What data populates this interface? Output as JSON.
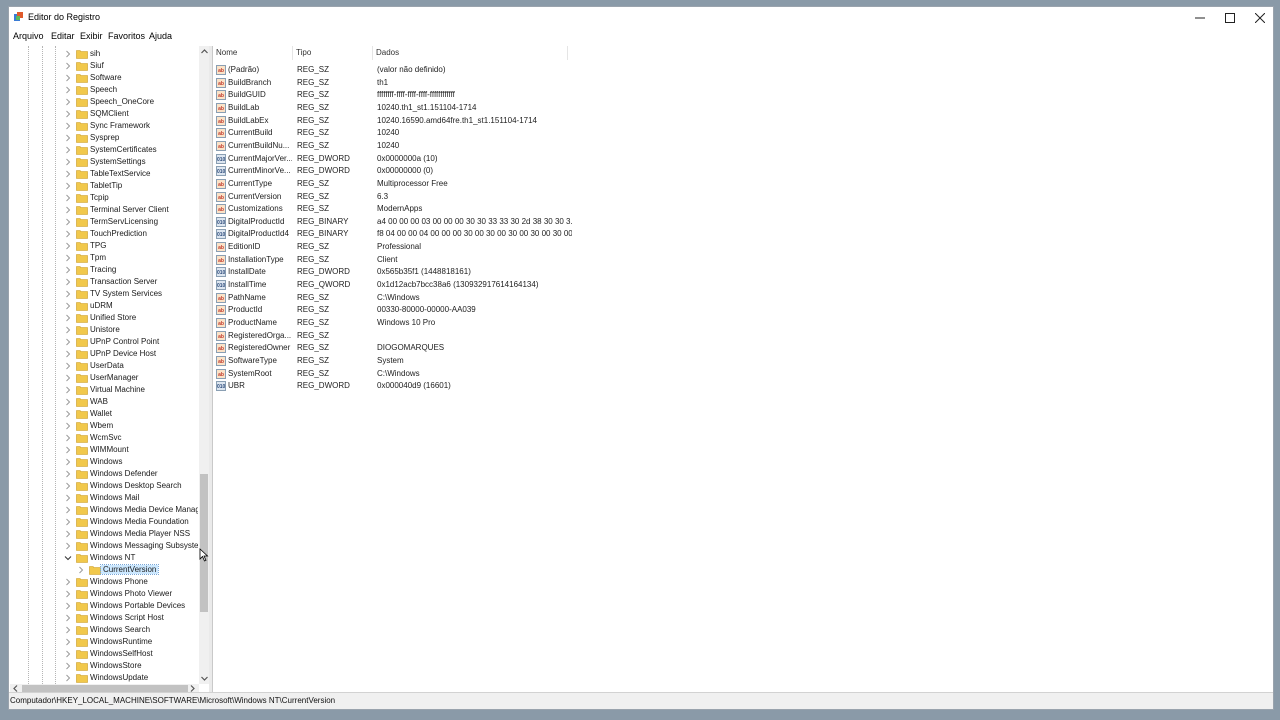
{
  "window": {
    "title": "Editor do Registro"
  },
  "menu": [
    "Arquivo",
    "Editar",
    "Exibir",
    "Favoritos",
    "Ajuda"
  ],
  "tree": {
    "items": [
      {
        "label": "sih",
        "expanded": false
      },
      {
        "label": "Siuf",
        "expanded": false
      },
      {
        "label": "Software",
        "expanded": false
      },
      {
        "label": "Speech",
        "expanded": false
      },
      {
        "label": "Speech_OneCore",
        "expanded": false
      },
      {
        "label": "SQMClient",
        "expanded": false
      },
      {
        "label": "Sync Framework",
        "expanded": false
      },
      {
        "label": "Sysprep",
        "expanded": false
      },
      {
        "label": "SystemCertificates",
        "expanded": false
      },
      {
        "label": "SystemSettings",
        "expanded": false
      },
      {
        "label": "TableTextService",
        "expanded": false
      },
      {
        "label": "TabletTip",
        "expanded": false
      },
      {
        "label": "Tcpip",
        "expanded": false
      },
      {
        "label": "Terminal Server Client",
        "expanded": false
      },
      {
        "label": "TermServLicensing",
        "expanded": false
      },
      {
        "label": "TouchPrediction",
        "expanded": false
      },
      {
        "label": "TPG",
        "expanded": false
      },
      {
        "label": "Tpm",
        "expanded": false
      },
      {
        "label": "Tracing",
        "expanded": false
      },
      {
        "label": "Transaction Server",
        "expanded": false
      },
      {
        "label": "TV System Services",
        "expanded": false
      },
      {
        "label": "uDRM",
        "expanded": false
      },
      {
        "label": "Unified Store",
        "expanded": false
      },
      {
        "label": "Unistore",
        "expanded": false
      },
      {
        "label": "UPnP Control Point",
        "expanded": false
      },
      {
        "label": "UPnP Device Host",
        "expanded": false
      },
      {
        "label": "UserData",
        "expanded": false
      },
      {
        "label": "UserManager",
        "expanded": false
      },
      {
        "label": "Virtual Machine",
        "expanded": false
      },
      {
        "label": "WAB",
        "expanded": false
      },
      {
        "label": "Wallet",
        "expanded": false
      },
      {
        "label": "Wbem",
        "expanded": false
      },
      {
        "label": "WcmSvc",
        "expanded": false
      },
      {
        "label": "WIMMount",
        "expanded": false
      },
      {
        "label": "Windows",
        "expanded": false
      },
      {
        "label": "Windows Defender",
        "expanded": false
      },
      {
        "label": "Windows Desktop Search",
        "expanded": false
      },
      {
        "label": "Windows Mail",
        "expanded": false
      },
      {
        "label": "Windows Media Device Manag",
        "expanded": false
      },
      {
        "label": "Windows Media Foundation",
        "expanded": false
      },
      {
        "label": "Windows Media Player NSS",
        "expanded": false
      },
      {
        "label": "Windows Messaging Subsyste",
        "expanded": false
      },
      {
        "label": "Windows NT",
        "expanded": true
      },
      {
        "label": "CurrentVersion",
        "expanded": false,
        "child": true,
        "selected": true
      },
      {
        "label": "Windows Phone",
        "expanded": false
      },
      {
        "label": "Windows Photo Viewer",
        "expanded": false
      },
      {
        "label": "Windows Portable Devices",
        "expanded": false
      },
      {
        "label": "Windows Script Host",
        "expanded": false
      },
      {
        "label": "Windows Search",
        "expanded": false
      },
      {
        "label": "WindowsRuntime",
        "expanded": false
      },
      {
        "label": "WindowsSelfHost",
        "expanded": false
      },
      {
        "label": "WindowsStore",
        "expanded": false
      },
      {
        "label": "WindowsUpdate",
        "expanded": false
      }
    ]
  },
  "columns": {
    "name": "Nome",
    "type": "Tipo",
    "data": "Dados"
  },
  "values": [
    {
      "icon": "string",
      "name": "(Padrão)",
      "type": "REG_SZ",
      "data": "(valor não definido)"
    },
    {
      "icon": "string",
      "name": "BuildBranch",
      "type": "REG_SZ",
      "data": "th1"
    },
    {
      "icon": "string",
      "name": "BuildGUID",
      "type": "REG_SZ",
      "data": "ffffffff-ffff-ffff-ffff-ffffffffffff"
    },
    {
      "icon": "string",
      "name": "BuildLab",
      "type": "REG_SZ",
      "data": "10240.th1_st1.151104-1714"
    },
    {
      "icon": "string",
      "name": "BuildLabEx",
      "type": "REG_SZ",
      "data": "10240.16590.amd64fre.th1_st1.151104-1714"
    },
    {
      "icon": "string",
      "name": "CurrentBuild",
      "type": "REG_SZ",
      "data": "10240"
    },
    {
      "icon": "string",
      "name": "CurrentBuildNu...",
      "type": "REG_SZ",
      "data": "10240"
    },
    {
      "icon": "binary",
      "name": "CurrentMajorVer...",
      "type": "REG_DWORD",
      "data": "0x0000000a (10)"
    },
    {
      "icon": "binary",
      "name": "CurrentMinorVe...",
      "type": "REG_DWORD",
      "data": "0x00000000 (0)"
    },
    {
      "icon": "string",
      "name": "CurrentType",
      "type": "REG_SZ",
      "data": "Multiprocessor Free"
    },
    {
      "icon": "string",
      "name": "CurrentVersion",
      "type": "REG_SZ",
      "data": "6.3"
    },
    {
      "icon": "string",
      "name": "Customizations",
      "type": "REG_SZ",
      "data": "ModernApps"
    },
    {
      "icon": "binary",
      "name": "DigitalProductId",
      "type": "REG_BINARY",
      "data": "a4 00 00 00 03 00 00 00 30 30 33 33 30 2d 38 30 30 3..."
    },
    {
      "icon": "binary",
      "name": "DigitalProductId4",
      "type": "REG_BINARY",
      "data": "f8 04 00 00 04 00 00 00 30 00 30 00 30 00 30 00 30 00..."
    },
    {
      "icon": "string",
      "name": "EditionID",
      "type": "REG_SZ",
      "data": "Professional"
    },
    {
      "icon": "string",
      "name": "InstallationType",
      "type": "REG_SZ",
      "data": "Client"
    },
    {
      "icon": "binary",
      "name": "InstallDate",
      "type": "REG_DWORD",
      "data": "0x565b35f1 (1448818161)"
    },
    {
      "icon": "binary",
      "name": "InstallTime",
      "type": "REG_QWORD",
      "data": "0x1d12acb7bcc38a6 (130932917614164134)"
    },
    {
      "icon": "string",
      "name": "PathName",
      "type": "REG_SZ",
      "data": "C:\\Windows"
    },
    {
      "icon": "string",
      "name": "ProductId",
      "type": "REG_SZ",
      "data": "00330-80000-00000-AA039"
    },
    {
      "icon": "string",
      "name": "ProductName",
      "type": "REG_SZ",
      "data": "Windows 10 Pro"
    },
    {
      "icon": "string",
      "name": "RegisteredOrga...",
      "type": "REG_SZ",
      "data": ""
    },
    {
      "icon": "string",
      "name": "RegisteredOwner",
      "type": "REG_SZ",
      "data": "DIOGOMARQUES"
    },
    {
      "icon": "string",
      "name": "SoftwareType",
      "type": "REG_SZ",
      "data": "System"
    },
    {
      "icon": "string",
      "name": "SystemRoot",
      "type": "REG_SZ",
      "data": "C:\\Windows"
    },
    {
      "icon": "binary",
      "name": "UBR",
      "type": "REG_DWORD",
      "data": "0x000040d9 (16601)"
    }
  ],
  "status": {
    "path": "Computador\\HKEY_LOCAL_MACHINE\\SOFTWARE\\Microsoft\\Windows NT\\CurrentVersion"
  },
  "colors": {
    "folder": "#f1c84b",
    "selection": "#cce8ff",
    "desktop": "#8a9aa8"
  }
}
